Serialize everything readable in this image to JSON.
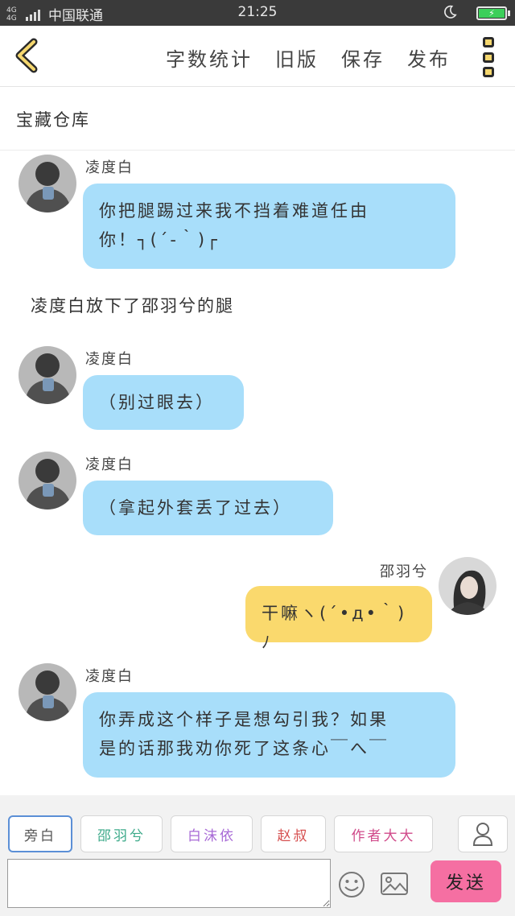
{
  "status": {
    "network": "4G 4G",
    "carrier": "中国联通",
    "time": "21:25",
    "battery_color": "#3ccf5a"
  },
  "topbar": {
    "actions": [
      "字数统计",
      "旧版",
      "保存",
      "发布"
    ]
  },
  "title": "宝藏仓库",
  "messages": [
    {
      "sender": "凌度白",
      "side": "left",
      "lines": [
        "你把腿踢过来我不挡着难道任由",
        "你！┐(´-｀)┌"
      ]
    },
    {
      "narration": "凌度白放下了邵羽兮的腿"
    },
    {
      "sender": "凌度白",
      "side": "left",
      "lines": [
        "（别过眼去）"
      ]
    },
    {
      "sender": "凌度白",
      "side": "left",
      "lines": [
        "（拿起外套丢了过去）"
      ]
    },
    {
      "sender": "邵羽兮",
      "side": "right",
      "lines": [
        "干嘛ヽ(´•д•｀)ﾉ"
      ]
    },
    {
      "sender": "凌度白",
      "side": "left",
      "lines": [
        "你弄成这个样子是想勾引我？如果",
        "是的话那我劝你死了这条心￣へ￣"
      ]
    }
  ],
  "composer": {
    "roles": [
      "旁白",
      "邵羽兮",
      "白沫依",
      "赵叔",
      "作者大大"
    ],
    "role_colors": [
      "#555555",
      "#3daa8a",
      "#a86ad6",
      "#d65050",
      "#d04a8a"
    ],
    "input_value": "",
    "send_label": "发送",
    "send_color": "#f56fa2"
  }
}
